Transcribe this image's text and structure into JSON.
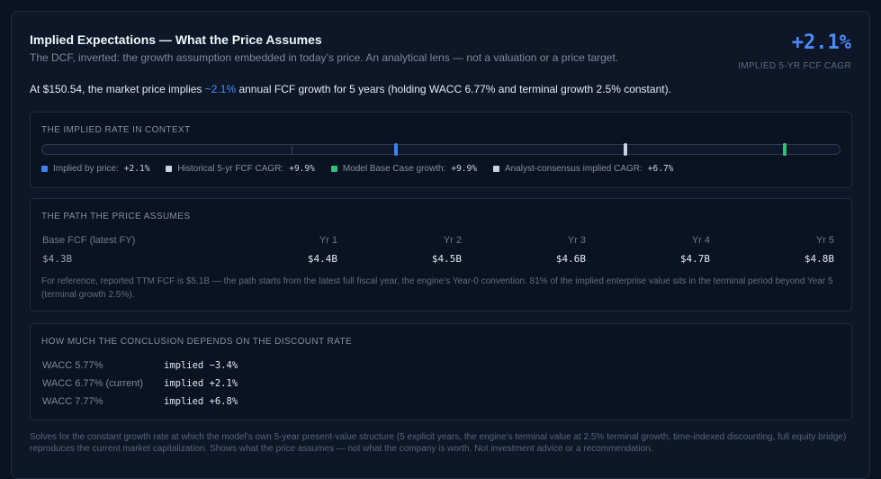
{
  "header": {
    "title": "Implied Expectations — What the Price Assumes",
    "subtitle": "The DCF, inverted: the growth assumption embedded in today’s price. An analytical lens — not a valuation or a price target.",
    "implied_value": "+2.1%",
    "implied_label": "IMPLIED 5-YR FCF CAGR"
  },
  "summary": {
    "prefix": "At $150.54, the market price implies ",
    "highlight": "~2.1%",
    "suffix": " annual FCF growth for 5 years (holding WACC 6.77% and terminal growth 2.5% constant)."
  },
  "context": {
    "title": "THE IMPLIED RATE IN CONTEXT",
    "range_pct": [
      -5,
      11
    ],
    "zero_tick": 0,
    "markers": [
      {
        "label": "Implied by price:",
        "value": "+2.1%",
        "rate": 2.1,
        "color": "#3b82f6"
      },
      {
        "label": "Historical 5-yr FCF CAGR:",
        "value": "+9.9%",
        "rate": 9.9,
        "color": "#cbd5e1"
      },
      {
        "label": "Model Base Case growth:",
        "value": "+9.9%",
        "rate": 9.9,
        "color": "#34c07a"
      },
      {
        "label": "Analyst-consensus implied CAGR:",
        "value": "+6.7%",
        "rate": 6.7,
        "color": "#cbd5e1"
      }
    ]
  },
  "path": {
    "title": "THE PATH THE PRICE ASSUMES",
    "headers": [
      "Base FCF (latest FY)",
      "Yr 1",
      "Yr 2",
      "Yr 3",
      "Yr 4",
      "Yr 5"
    ],
    "values": [
      "$4.3B",
      "$4.4B",
      "$4.5B",
      "$4.6B",
      "$4.7B",
      "$4.8B"
    ],
    "note": "For reference, reported TTM FCF is $5.1B — the path starts from the latest full fiscal year, the engine’s Year-0 convention. 81% of the implied enterprise value sits in the terminal period beyond Year 5 (terminal growth 2.5%)."
  },
  "sensitivity": {
    "title": "HOW MUCH THE CONCLUSION DEPENDS ON THE DISCOUNT RATE",
    "rows": [
      {
        "wacc": "WACC 5.77%",
        "implied": "implied −3.4%"
      },
      {
        "wacc": "WACC 6.77% (current)",
        "implied": "implied +2.1%"
      },
      {
        "wacc": "WACC 7.77%",
        "implied": "implied +6.8%"
      }
    ]
  },
  "footer": "Solves for the constant growth rate at which the model’s own 5-year present-value structure (5 explicit years, the engine’s terminal value at 2.5% terminal growth, time-indexed discounting, full equity bridge) reproduces the current market capitalization. Shows what the price assumes — not what the company is worth. Not investment advice or a recommendation."
}
